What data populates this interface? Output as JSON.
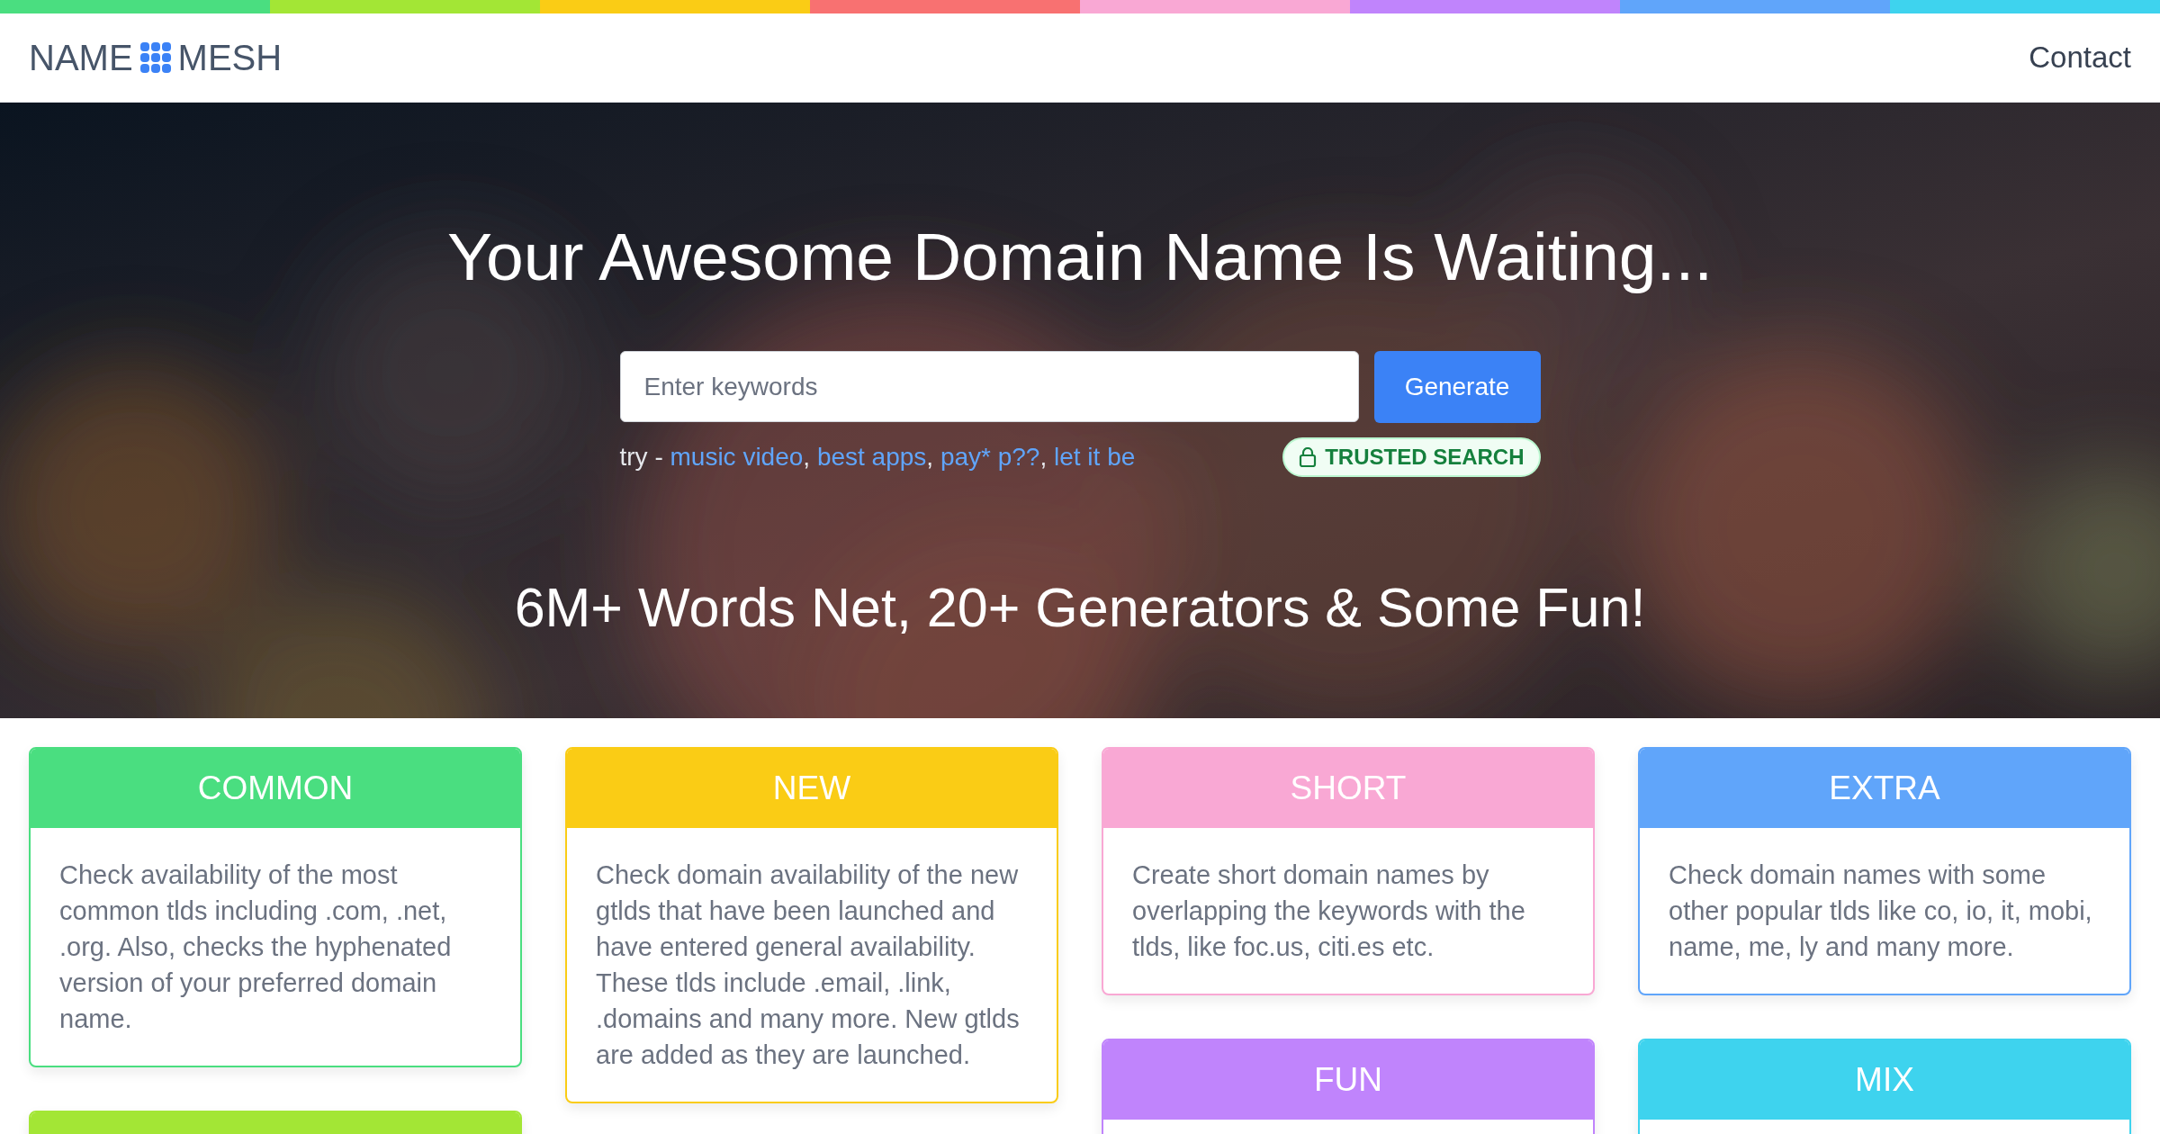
{
  "header": {
    "logo_left": "NAME",
    "logo_right": "MESH",
    "nav": [
      {
        "label": "Contact"
      }
    ]
  },
  "hero": {
    "title": "Your Awesome Domain Name Is Waiting...",
    "search": {
      "placeholder": "Enter keywords",
      "button": "Generate"
    },
    "try_label": "try -",
    "examples": [
      "music video",
      "best apps",
      "pay* p??",
      "let it be"
    ],
    "separator": ",",
    "badge": "TRUSTED SEARCH",
    "subtitle": "6M+ Words Net, 20+ Generators & Some Fun!"
  },
  "columns": [
    [
      {
        "title": "COMMON",
        "color": "#4ade80",
        "text": "Check availability of the most common tlds including .com, .net, .org. Also, checks the hyphenated version of your preferred domain name."
      },
      {
        "color": "#a3e635"
      }
    ],
    [
      {
        "title": "NEW",
        "color": "#facc15",
        "text": "Check domain availability of the new gtlds that have been launched and have entered general availability. These tlds include .email, .link, .domains and many more. New gtlds are added as they are launched."
      }
    ],
    [
      {
        "title": "SHORT",
        "color": "#f9a8d4",
        "text": "Create short domain names by overlapping the keywords with the tlds, like foc.us, citi.es etc."
      },
      {
        "title": "FUN",
        "color": "#c084fc"
      }
    ],
    [
      {
        "title": "EXTRA",
        "color": "#60a5fa",
        "text": "Check domain names with some other popular tlds like co, io, it, mobi, name, me, ly and many more."
      },
      {
        "title": "MIX",
        "color": "#3ed3ee"
      }
    ]
  ]
}
